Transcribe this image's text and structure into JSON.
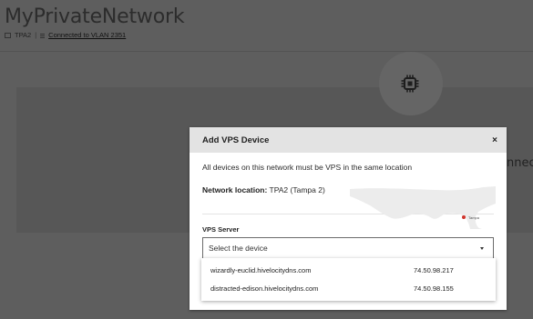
{
  "header": {
    "title": "MyPrivateNetwork",
    "location_code": "TPA2",
    "separator": "|",
    "vlan_link": "Connected to VLAN 2351"
  },
  "background": {
    "connection_fragment": "nnec",
    "chip_icon": "chip-icon"
  },
  "modal": {
    "title": "Add VPS Device",
    "close_label": "×",
    "info_text": "All devices on this network must be VPS in the same location",
    "location_label": "Network location:",
    "location_value": "TPA2 (Tampa 2)",
    "map_marker_label": "Tampa",
    "field_label": "VPS Server",
    "select_value": "Select the device",
    "options": [
      {
        "name": "wizardly-euclid.hivelocitydns.com",
        "ip": "74.50.98.217"
      },
      {
        "name": "distracted-edison.hivelocitydns.com",
        "ip": "74.50.98.155"
      }
    ]
  },
  "colors": {
    "overlay": "#5e5e5e",
    "modal_header": "#e3e3e3",
    "map_marker": "#d0342c"
  }
}
